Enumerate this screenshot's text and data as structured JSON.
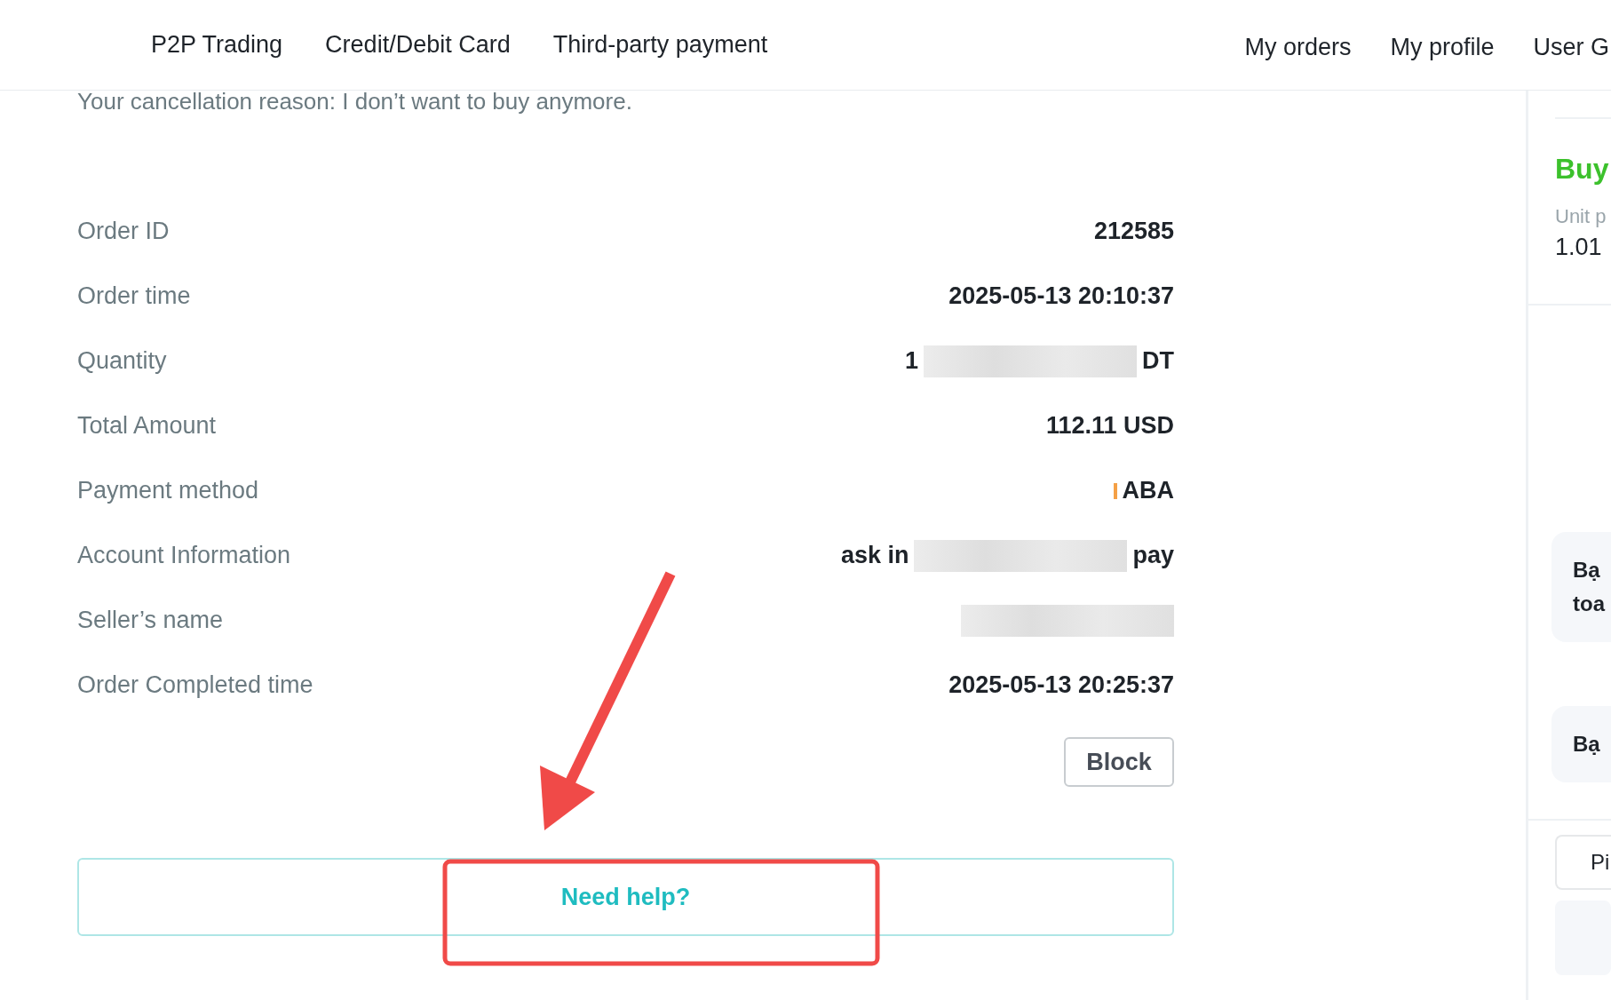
{
  "nav": {
    "left": [
      "P2P Trading",
      "Credit/Debit Card",
      "Third-party payment"
    ],
    "right": [
      "My orders",
      "My profile",
      "User G"
    ]
  },
  "cancellation_reason": "Your cancellation reason: I don’t want to buy anymore.",
  "details": [
    {
      "label": "Order ID",
      "parts": [
        {
          "kind": "text",
          "text": "212585"
        }
      ]
    },
    {
      "label": "Order time",
      "parts": [
        {
          "kind": "text",
          "text": "2025-05-13 20:10:37"
        }
      ]
    },
    {
      "label": "Quantity",
      "parts": [
        {
          "kind": "text",
          "text": "1"
        },
        {
          "kind": "redacted"
        },
        {
          "kind": "text",
          "text": "DT"
        }
      ]
    },
    {
      "label": "Total Amount",
      "parts": [
        {
          "kind": "text",
          "text": "112.11 USD"
        }
      ]
    },
    {
      "label": "Payment method",
      "parts": [
        {
          "kind": "marker",
          "color": "#f5a046"
        },
        {
          "kind": "text",
          "text": "ABA"
        }
      ]
    },
    {
      "label": "Account Information",
      "parts": [
        {
          "kind": "text",
          "text": "ask in"
        },
        {
          "kind": "redacted"
        },
        {
          "kind": "text",
          "text": "pay"
        }
      ]
    },
    {
      "label": "Seller’s name",
      "parts": [
        {
          "kind": "redacted"
        }
      ]
    },
    {
      "label": "Order Completed time",
      "parts": [
        {
          "kind": "text",
          "text": "2025-05-13 20:25:37"
        }
      ]
    }
  ],
  "block_button": "Block",
  "help_button": "Need help?",
  "side_panel": {
    "title": "Buy",
    "unit_label": "Unit p",
    "unit_value": "1.01",
    "cards": [
      {
        "lines": [
          "Bạ",
          "toa"
        ]
      },
      {
        "lines": [
          "Bạ"
        ]
      }
    ],
    "button": "Pi"
  }
}
